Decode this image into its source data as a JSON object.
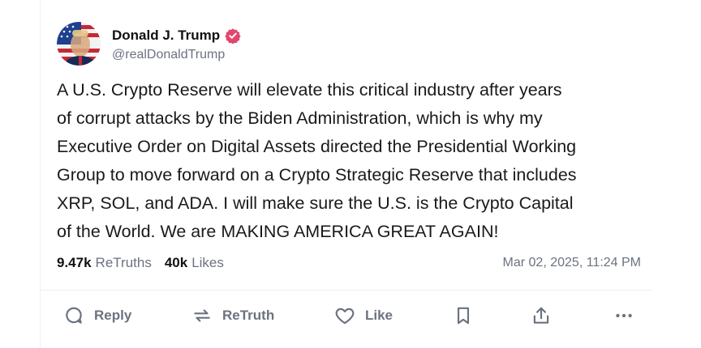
{
  "post": {
    "author": {
      "display_name": "Donald J. Trump",
      "handle": "@realDonaldTrump",
      "verified": true,
      "verified_color": "#e3466d"
    },
    "text": "A U.S. Crypto Reserve will elevate this critical industry after years\nof corrupt attacks by the Biden Administration, which is why my\nExecutive Order on Digital Assets directed the Presidential Working\nGroup to move forward on a Crypto Strategic Reserve that includes\nXRP, SOL, and ADA. I will make sure the U.S. is the Crypto Capital\nof the World. We are MAKING AMERICA GREAT AGAIN!",
    "stats": {
      "retruths_count": "9.47k",
      "retruths_label": "ReTruths",
      "likes_count": "40k",
      "likes_label": "Likes"
    },
    "timestamp": "Mar 02, 2025, 11:24 PM"
  },
  "actions": {
    "reply_label": "Reply",
    "retruth_label": "ReTruth",
    "like_label": "Like",
    "bookmark_icon": "bookmark-icon",
    "share_icon": "share-icon",
    "more_icon": "more-icon"
  },
  "colors": {
    "text": "#1a1a1a",
    "muted": "#6b7280",
    "divider": "#eceef1"
  }
}
